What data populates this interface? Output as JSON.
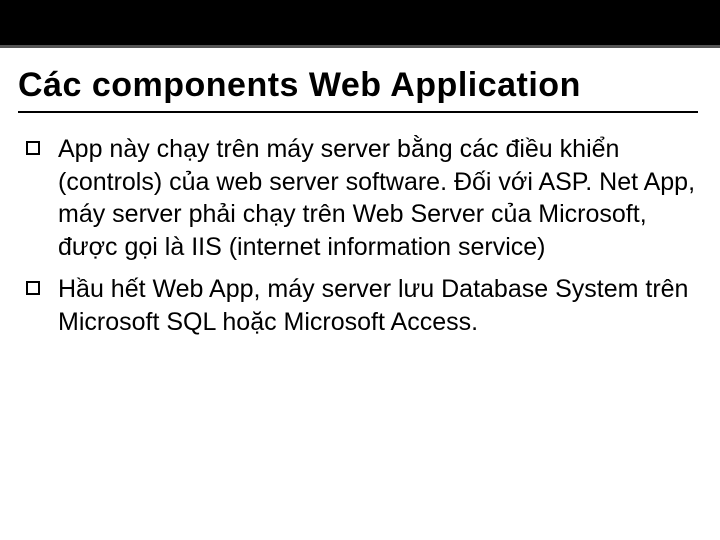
{
  "slide": {
    "title": "Các components Web Application",
    "bullets": [
      {
        "text": "App này chạy trên máy server bằng các điều khiển (controls) của web server software. Đối với ASP. Net App, máy server phải chạy trên Web Server của Microsoft, được gọi là IIS (internet information service)"
      },
      {
        "text": "Hầu hết Web App, máy server lưu Database System trên Microsoft SQL hoặc Microsoft Access."
      }
    ]
  }
}
